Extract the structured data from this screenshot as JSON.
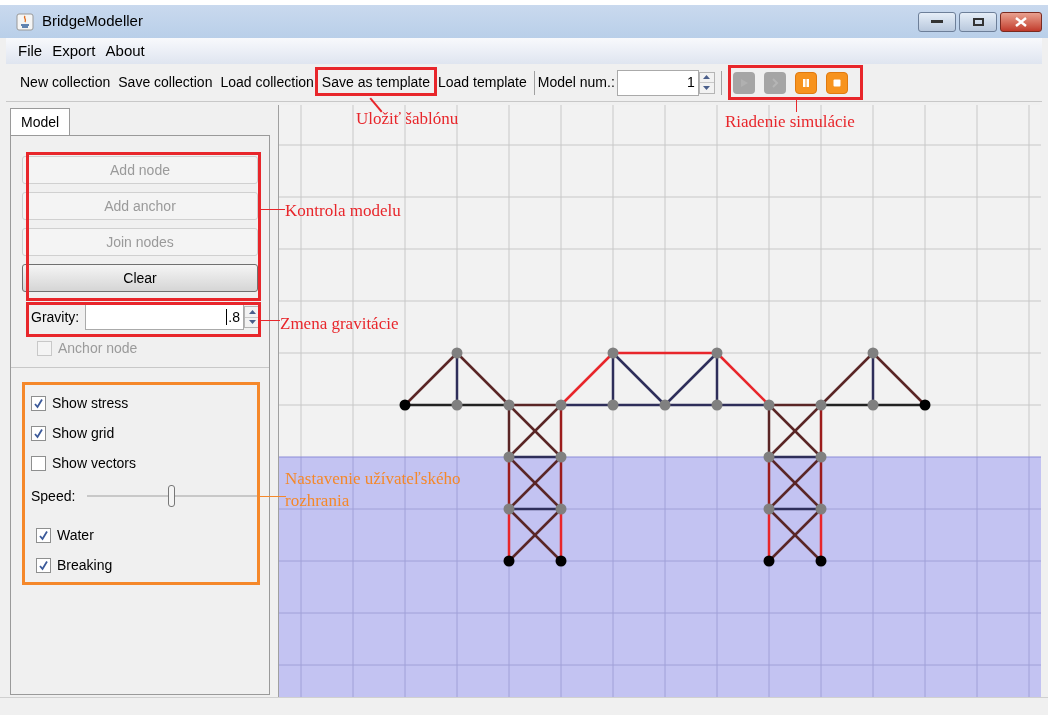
{
  "window": {
    "title": "BridgeModeller"
  },
  "menu": [
    "File",
    "Export",
    "About"
  ],
  "toolbar": {
    "buttons": [
      "New collection",
      "Save collection",
      "Load collection",
      "Save as template",
      "Load template"
    ],
    "model_num": {
      "label": "Model num.:",
      "value": "1"
    },
    "sim_controls": [
      {
        "kind": "play",
        "disabled": true
      },
      {
        "kind": "step",
        "disabled": true
      },
      {
        "kind": "pause",
        "disabled": false
      },
      {
        "kind": "stop",
        "disabled": false
      }
    ]
  },
  "tabs": [
    {
      "label": "Model",
      "selected": true
    }
  ],
  "model_buttons": [
    {
      "label": "Add node",
      "disabled": true
    },
    {
      "label": "Add anchor",
      "disabled": true
    },
    {
      "label": "Join nodes",
      "disabled": true
    },
    {
      "label": "Clear",
      "disabled": false
    }
  ],
  "gravity": {
    "label": "Gravity:",
    "value": ".8"
  },
  "anchor_node": {
    "label": "Anchor node",
    "checked": false,
    "disabled": true
  },
  "view_options": [
    {
      "kind": "checkbox",
      "label": "Show stress",
      "checked": true
    },
    {
      "kind": "checkbox",
      "label": "Show grid",
      "checked": true
    },
    {
      "kind": "checkbox",
      "label": "Show vectors",
      "checked": false
    },
    {
      "kind": "slider",
      "label": "Speed:",
      "level": 0.5
    },
    {
      "kind": "checkbox",
      "label": "Water",
      "checked": true
    },
    {
      "kind": "checkbox",
      "label": "Breaking",
      "checked": true
    }
  ],
  "annotations": [
    {
      "text": "Uložiť šablónu",
      "color": "#e8262b"
    },
    {
      "text": "Riadenie simulácie",
      "color": "#e8262b"
    },
    {
      "text": "Kontrola modelu",
      "color": "#e8262b"
    },
    {
      "text": "Zmena gravitácie",
      "color": "#e8262b"
    },
    {
      "text": "Nastavenie užívateľského rozhrania",
      "color": "#f5882a"
    }
  ]
}
